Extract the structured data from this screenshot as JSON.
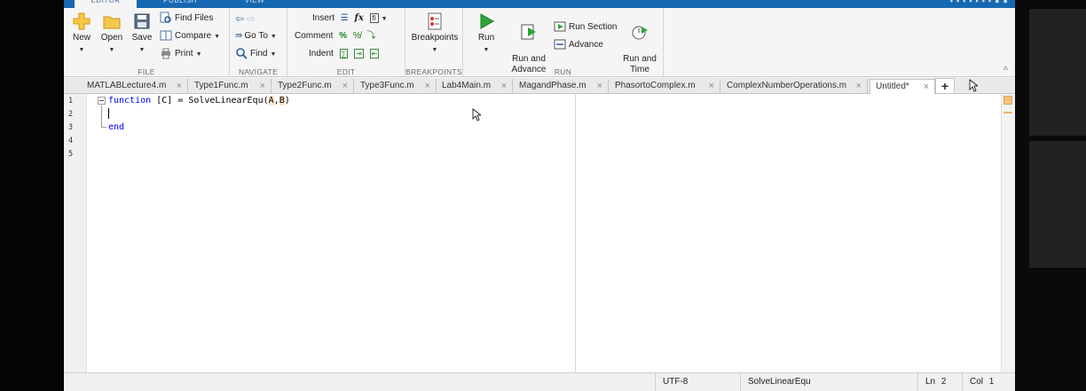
{
  "toolstrip": {
    "tabs": [
      {
        "label": "EDITOR",
        "active": true
      },
      {
        "label": "PUBLISH",
        "active": false
      },
      {
        "label": "VIEW",
        "active": false
      }
    ]
  },
  "ribbon": {
    "file": {
      "label": "FILE",
      "new_label": "New",
      "open_label": "Open",
      "save_label": "Save",
      "find_files_label": "Find Files",
      "compare_label": "Compare",
      "print_label": "Print"
    },
    "navigate": {
      "label": "NAVIGATE",
      "goto_label": "Go To",
      "find_label": "Find"
    },
    "edit": {
      "label": "EDIT",
      "insert_label": "Insert",
      "comment_label": "Comment",
      "indent_label": "Indent",
      "fx_label": "fx",
      "percent_label": "%"
    },
    "breakpoints": {
      "label": "BREAKPOINTS",
      "breakpoints_label": "Breakpoints"
    },
    "run": {
      "label": "RUN",
      "run_label": "Run",
      "run_advance_label": "Run and\nAdvance",
      "run_section_label": "Run Section",
      "advance_label": "Advance",
      "run_time_label": "Run and\nTime"
    }
  },
  "doc_tabs": [
    {
      "label": "MATLABLecture4.m",
      "active": false
    },
    {
      "label": "Type1Func.m",
      "active": false
    },
    {
      "label": "Type2Func.m",
      "active": false
    },
    {
      "label": "Type3Func.m",
      "active": false
    },
    {
      "label": "Lab4Main.m",
      "active": false
    },
    {
      "label": "MagandPhase.m",
      "active": false
    },
    {
      "label": "PhasortoComplex.m",
      "active": false
    },
    {
      "label": "ComplexNumberOperations.m",
      "active": false
    },
    {
      "label": "Untitled*",
      "active": true
    }
  ],
  "tab_close_glyph": "×",
  "tab_add_glyph": "+",
  "editor": {
    "line_numbers": [
      "1",
      "2",
      "3",
      "4",
      "5"
    ],
    "code": {
      "line1_kw": "function",
      "line1_pre": " [C] = SolveLinearEqu(",
      "line1_a": "A",
      "line1_comma": ",",
      "line1_b": "B",
      "line1_post": ")",
      "line3_kw": "end"
    }
  },
  "statusbar": {
    "encoding": "UTF-8",
    "function_name": "SolveLinearEqu",
    "ln_label": "Ln",
    "ln_value": "2",
    "col_label": "Col",
    "col_value": "1"
  },
  "colors": {
    "accent": "#1768b2",
    "keyword": "#0000ff",
    "match_highlight": "#fbe6c2"
  }
}
